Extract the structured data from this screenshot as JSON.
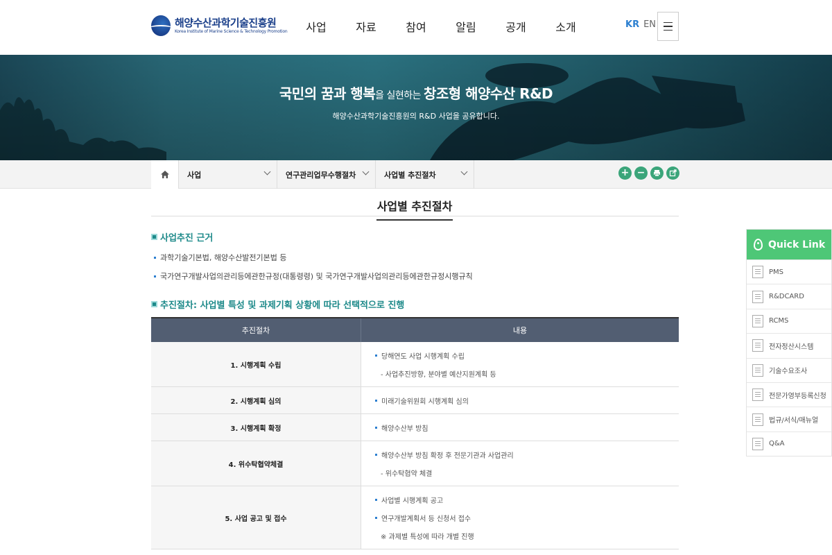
{
  "header": {
    "logo_ko": "해양수산과학기술진흥원",
    "logo_en": "Korea Institute of Marine Science & Technology Promotion",
    "nav": [
      "사업",
      "자료",
      "참여",
      "알림",
      "공개",
      "소개"
    ],
    "lang_kr": "KR",
    "lang_en": "EN"
  },
  "hero": {
    "title_a": "국민의 꿈과 행복",
    "title_b": "을 실현하는 ",
    "title_c": "창조형 해양수산 R&D",
    "subtitle": "해양수산과학기술진흥원의 R&D 사업을 공유합니다."
  },
  "breadcrumb": {
    "level1": "사업",
    "level2": "연구관리업무수행절차",
    "level3": "사업별 추진절차"
  },
  "page": {
    "title": "사업별 추진절차"
  },
  "section1": {
    "title": "사업추진 근거",
    "items": [
      "과학기술기본법, 해양수산발전기본법 등",
      "국가연구개발사업의관리등에관한규정(대통령령) 및 국가연구개발사업의관리등에관한규정시행규칙"
    ]
  },
  "section2": {
    "title": "추진절차: 사업별 특성 및 과제기획 상황에 따라 선택적으로 진행"
  },
  "table": {
    "headers": [
      "추진절차",
      "내용"
    ],
    "rows": [
      {
        "step": "1. 시행계획 수립",
        "lines": [
          {
            "text": "당해연도 사업 시행계획 수립",
            "type": "bullet"
          },
          {
            "text": "- 사업추진방향, 분야별 예산지원계획 등",
            "type": "sub"
          }
        ]
      },
      {
        "step": "2. 시행계획 심의",
        "lines": [
          {
            "text": "미래기술위원회 시행계획 심의",
            "type": "bullet"
          }
        ]
      },
      {
        "step": "3. 시행계획 확정",
        "lines": [
          {
            "text": "해양수산부 방침",
            "type": "bullet"
          }
        ]
      },
      {
        "step": "4. 위수탁협약체결",
        "lines": [
          {
            "text": "해양수산부 방침 확정 후 전문기관과 사업관리",
            "type": "bullet"
          },
          {
            "text": "- 위수탁협약 체결",
            "type": "sub"
          }
        ]
      },
      {
        "step": "5. 사업 공고 및 접수",
        "lines": [
          {
            "text": "사업별 시행계획 공고",
            "type": "bullet"
          },
          {
            "text": "연구개발계획서 등 신청서 접수",
            "type": "bullet"
          },
          {
            "text": "※ 과제별 특성에 따라 개별 진행",
            "type": "sub"
          }
        ]
      }
    ]
  },
  "quicklink": {
    "title": "Quick Link",
    "items": [
      "PMS",
      "R&DCARD",
      "RCMS",
      "전자정산시스템",
      "기술수요조사",
      "전문가영부등록신청",
      "법규/서식/매뉴얼",
      "Q&A"
    ]
  }
}
